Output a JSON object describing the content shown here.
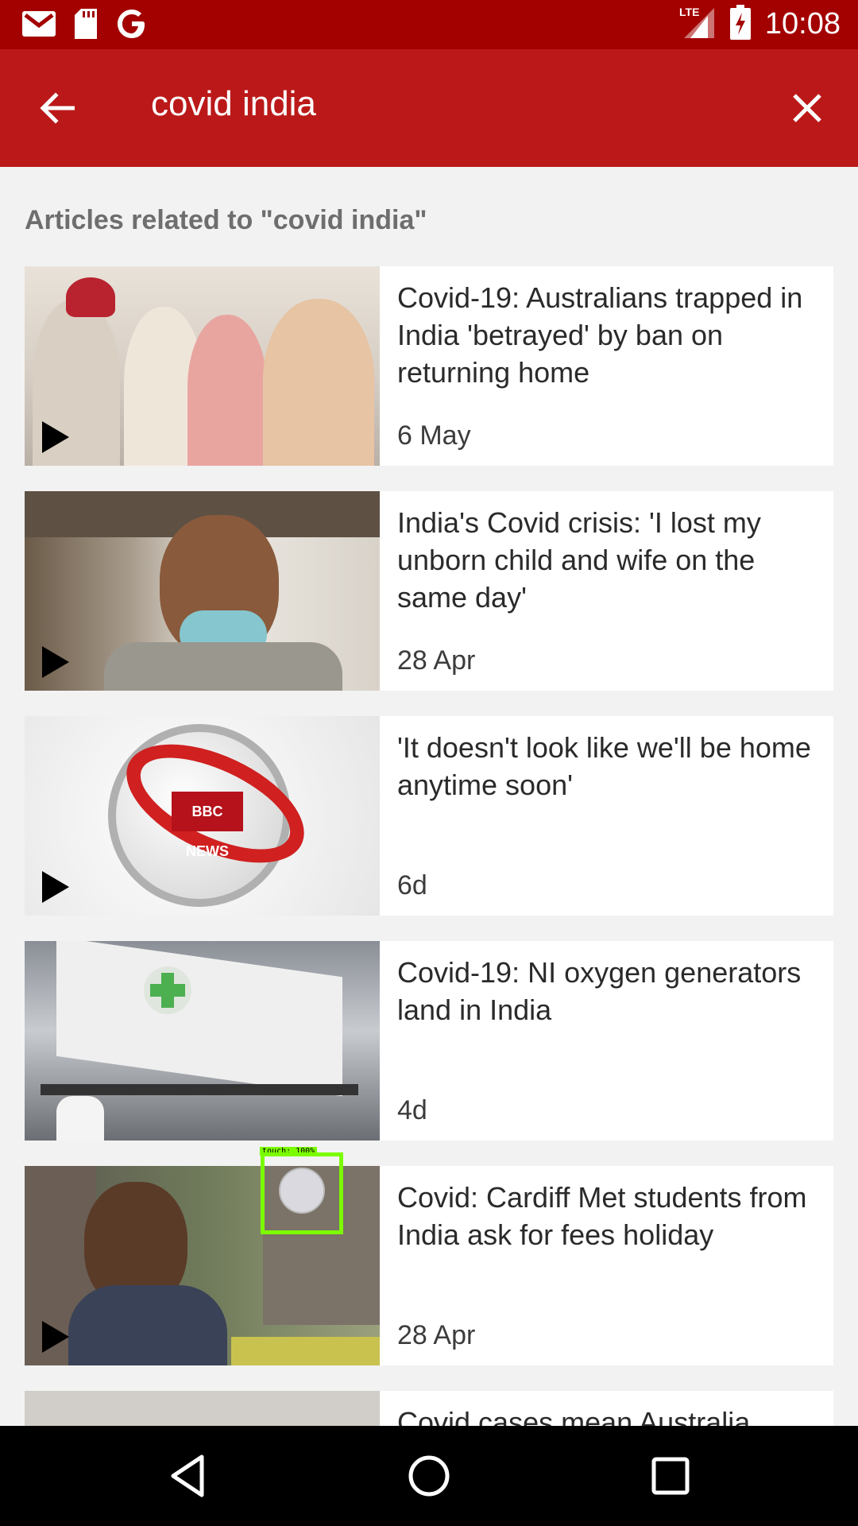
{
  "status_bar": {
    "time": "10:08",
    "network": "LTE",
    "left_icons": [
      "gmail-icon",
      "sd-card-icon",
      "google-icon"
    ],
    "right_icons": [
      "lte-signal-icon",
      "battery-charging-icon"
    ]
  },
  "app_bar": {
    "query": "covid india",
    "back_icon": "arrow-back-icon",
    "close_icon": "close-icon"
  },
  "results": {
    "header": "Articles related to \"covid india\"",
    "items": [
      {
        "title": "Covid-19: Australians trapped in India 'betrayed' by ban on returning home",
        "date": "6 May",
        "video": true
      },
      {
        "title": "India's Covid crisis: 'I lost my unborn child and wife on the same day'",
        "date": "28 Apr",
        "video": true
      },
      {
        "title": "'It doesn't look like we'll be home anytime soon'",
        "date": "6d",
        "video": true,
        "thumb_label": "BBC NEWS"
      },
      {
        "title": "Covid-19: NI oxygen generators land in India",
        "date": "4d",
        "video": false
      },
      {
        "title": "Covid: Cardiff Met students from India ask for fees holiday",
        "date": "28 Apr",
        "video": true
      },
      {
        "title": "Covid cases mean Australia",
        "date": "",
        "video": false
      }
    ]
  },
  "touch_overlay": {
    "label": "touch: 100%"
  },
  "nav_bar": {
    "buttons": [
      "back-triangle-icon",
      "home-circle-icon",
      "recents-square-icon"
    ]
  },
  "colors": {
    "status_bar": "#a30000",
    "app_bar": "#bb1919",
    "background": "#f2f2f2"
  }
}
